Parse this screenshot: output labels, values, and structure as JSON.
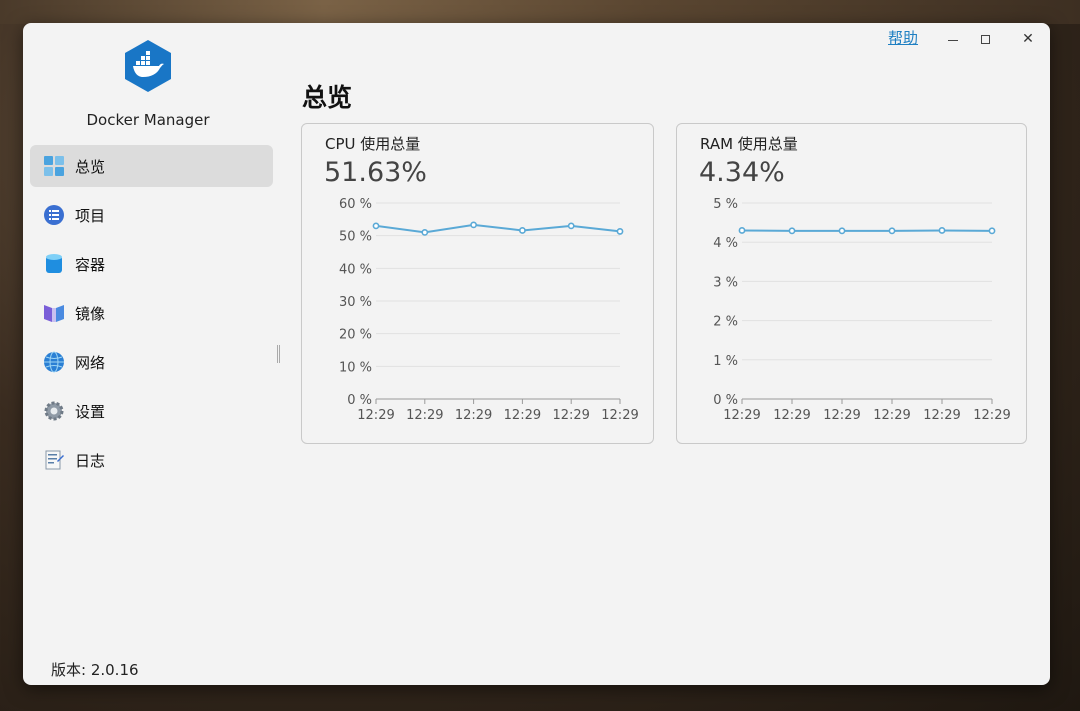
{
  "app": {
    "name": "Docker Manager",
    "version_label": "版本: 2.0.16",
    "help_label": "帮助"
  },
  "sidebar": {
    "items": [
      {
        "label": "总览",
        "icon": "overview-grid-icon",
        "active": true
      },
      {
        "label": "项目",
        "icon": "list-icon",
        "active": false
      },
      {
        "label": "容器",
        "icon": "cylinder-icon",
        "active": false
      },
      {
        "label": "镜像",
        "icon": "image-panels-icon",
        "active": false
      },
      {
        "label": "网络",
        "icon": "globe-icon",
        "active": false
      },
      {
        "label": "设置",
        "icon": "gear-icon",
        "active": false
      },
      {
        "label": "日志",
        "icon": "document-icon",
        "active": false
      }
    ]
  },
  "main": {
    "title": "总览"
  },
  "cpu": {
    "title": "CPU 使用总量",
    "value": "51.63%"
  },
  "ram": {
    "title": "RAM 使用总量",
    "value": "4.34%"
  },
  "colors": {
    "accent": "#1e7fc2",
    "line": "#5aa9d6",
    "sidebar_active": "#dcdcdc"
  },
  "chart_data": [
    {
      "type": "line",
      "id": "cpu",
      "x": [
        "12:29",
        "12:29",
        "12:29",
        "12:29",
        "12:29",
        "12:29"
      ],
      "series": [
        {
          "values": [
            53,
            51,
            53.3,
            51.6,
            53,
            51.3
          ]
        }
      ],
      "yticks": [
        "0 %",
        "10 %",
        "20 %",
        "30 %",
        "40 %",
        "50 %",
        "60 %"
      ],
      "ylim": [
        0,
        60
      ]
    },
    {
      "type": "line",
      "id": "ram",
      "x": [
        "12:29",
        "12:29",
        "12:29",
        "12:29",
        "12:29",
        "12:29"
      ],
      "series": [
        {
          "values": [
            4.3,
            4.29,
            4.29,
            4.29,
            4.3,
            4.29
          ]
        }
      ],
      "yticks": [
        "0 %",
        "1 %",
        "2 %",
        "3 %",
        "4 %",
        "5 %"
      ],
      "ylim": [
        0,
        5
      ]
    }
  ]
}
